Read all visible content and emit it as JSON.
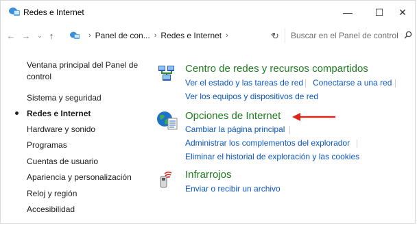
{
  "window": {
    "title": "Redes e Internet",
    "minimize": "—",
    "maximize": "☐",
    "close": "✕"
  },
  "nav": {
    "back": "←",
    "forward": "→",
    "recent": "⌄",
    "up": "↑",
    "breadcrumbs": [
      "Panel de con...",
      "Redes e Internet"
    ],
    "separator": "›",
    "dropdown": "⌄",
    "refresh": "↻",
    "search_placeholder": "Buscar en el Panel de control"
  },
  "sidebar": {
    "items": [
      {
        "label": "Ventana principal del Panel de",
        "label2": "control"
      },
      {
        "label": "Sistema y seguridad"
      },
      {
        "label": "Redes e Internet",
        "active": true
      },
      {
        "label": "Hardware y sonido"
      },
      {
        "label": "Programas"
      },
      {
        "label": "Cuentas de usuario"
      },
      {
        "label": "Apariencia y personalización"
      },
      {
        "label": "Reloj y región"
      },
      {
        "label": "Accesibilidad"
      }
    ]
  },
  "categories": [
    {
      "icon": "network-center-icon",
      "title": "Centro de redes y recursos compartidos",
      "links": [
        "Ver el estado y las tareas de red",
        "Conectarse a una red",
        "Ver los equipos y dispositivos de red"
      ]
    },
    {
      "icon": "internet-options-icon",
      "title": "Opciones de Internet",
      "links": [
        "Cambiar la página principal",
        "Administrar los complementos del explorador",
        "Eliminar el historial de exploración y las cookies"
      ]
    },
    {
      "icon": "infrared-icon",
      "title": "Infrarrojos",
      "links": [
        "Enviar o recibir un archivo"
      ]
    }
  ],
  "colors": {
    "category_title": "#1e7d1e",
    "link": "#0a56c4",
    "annotation_arrow": "#d9251c"
  }
}
